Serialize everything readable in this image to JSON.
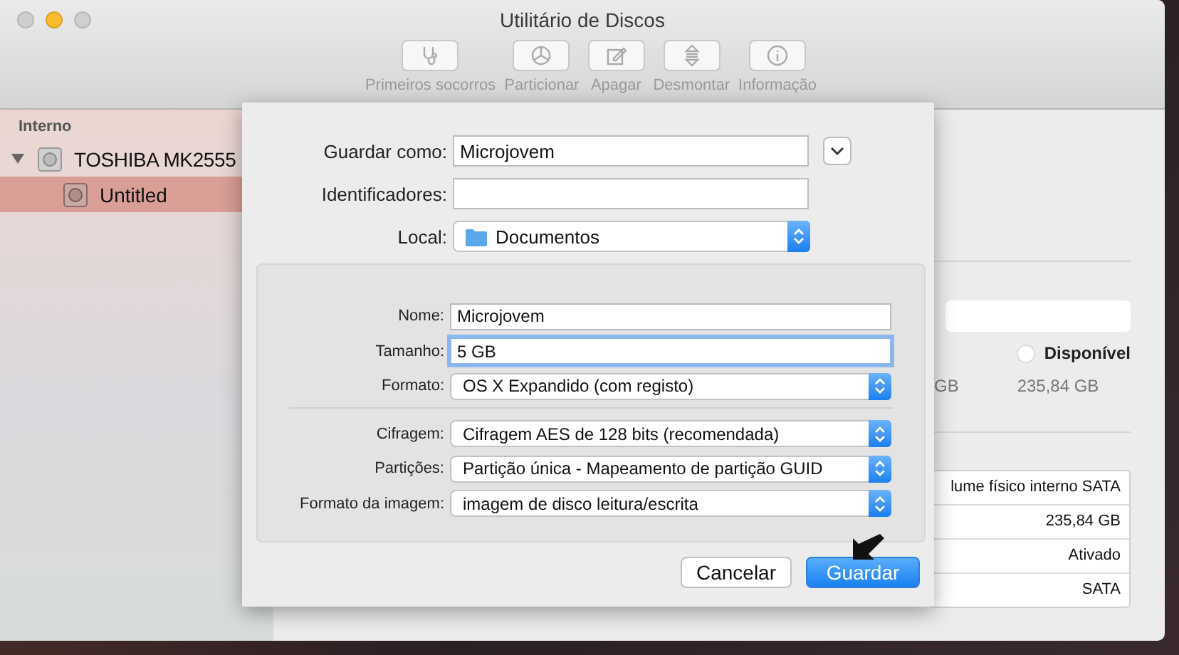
{
  "window": {
    "title": "Utilitário de Discos"
  },
  "toolbar": [
    {
      "label": "Primeiros socorros",
      "disabled": true
    },
    {
      "label": "Particionar",
      "disabled": true
    },
    {
      "label": "Apagar",
      "disabled": true
    },
    {
      "label": "Desmontar",
      "disabled": true
    },
    {
      "label": "Informação",
      "disabled": true
    }
  ],
  "sidebar": {
    "section": "Interno",
    "items": [
      {
        "label": "TOSHIBA MK2555",
        "expanded": true,
        "selected": false,
        "children": [
          {
            "label": "Untitled",
            "selected": true
          }
        ]
      }
    ]
  },
  "background_panel": {
    "partial_value": "GB",
    "legend_label": "Disponível",
    "legend_value": "235,84 GB",
    "info_rows": [
      "lume físico interno SATA",
      "235,84 GB",
      "Ativado",
      "SATA"
    ]
  },
  "sheet": {
    "save_as": {
      "label": "Guardar como:",
      "value": "Microjovem"
    },
    "tags": {
      "label": "Identificadores:"
    },
    "location": {
      "label": "Local:",
      "value": "Documentos"
    },
    "options": [
      {
        "kind": "text",
        "label": "Nome:",
        "value": "Microjovem",
        "focused": false
      },
      {
        "kind": "text",
        "label": "Tamanho:",
        "value": "5 GB",
        "focused": true
      },
      {
        "kind": "popup",
        "label": "Formato:",
        "value": "OS X Expandido (com registo)"
      },
      {
        "kind": "divider"
      },
      {
        "kind": "popup",
        "label": "Cifragem:",
        "value": "Cifragem AES de 128 bits (recomendada)"
      },
      {
        "kind": "popup",
        "label": "Partições:",
        "value": "Partição única - Mapeamento de partição GUID"
      },
      {
        "kind": "popup",
        "label": "Formato da imagem:",
        "value": "imagem de disco leitura/escrita"
      }
    ],
    "buttons": [
      {
        "label": "Cancelar",
        "default": false
      },
      {
        "label": "Guardar",
        "default": true
      }
    ]
  }
}
